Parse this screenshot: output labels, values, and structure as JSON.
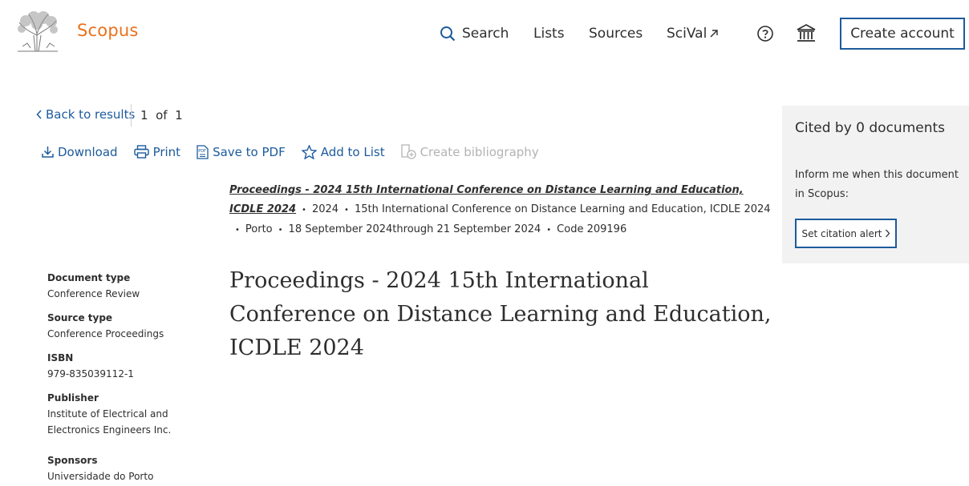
{
  "header": {
    "brand": "Scopus",
    "nav": {
      "search": "Search",
      "lists": "Lists",
      "sources": "Sources",
      "scival": "SciVal"
    },
    "create_account": "Create account"
  },
  "navigation": {
    "back_to_results": "Back to results",
    "pager": "1  of  1"
  },
  "toolbar": {
    "download": "Download",
    "print": "Print",
    "save_pdf": "Save to PDF",
    "add_to_list": "Add to List",
    "create_bibliography": "Create bibliography"
  },
  "source": {
    "title": "Proceedings - 2024 15th International Conference on Distance Learning and Education, ICDLE 2024",
    "year": "2024",
    "conference": "15th International Conference on Distance Learning and Education, ICDLE 2024",
    "location": "Porto",
    "dates": "18 September 2024through 21 September 2024",
    "code": "Code 209196"
  },
  "document": {
    "title": "Proceedings - 2024 15th International Conference on Distance Learning and Education, ICDLE 2024"
  },
  "metadata": {
    "document_type_label": "Document type",
    "document_type": "Conference Review",
    "source_type_label": "Source type",
    "source_type": "Conference Proceedings",
    "isbn_label": "ISBN",
    "isbn": "979-835039112-1",
    "publisher_label": "Publisher",
    "publisher": "Institute of Electrical and Electronics Engineers Inc.",
    "sponsors_label": "Sponsors",
    "sponsors": "Universidade do Porto"
  },
  "cited_panel": {
    "title": "Cited by 0 documents",
    "inform_text": "Inform me when this document in Scopus:",
    "alert_button": "Set citation alert"
  },
  "colors": {
    "brand_orange": "#e9711c",
    "link_blue": "#1c5b9c",
    "panel_gray": "#f2f2f2",
    "disabled": "#b3b3b3"
  }
}
